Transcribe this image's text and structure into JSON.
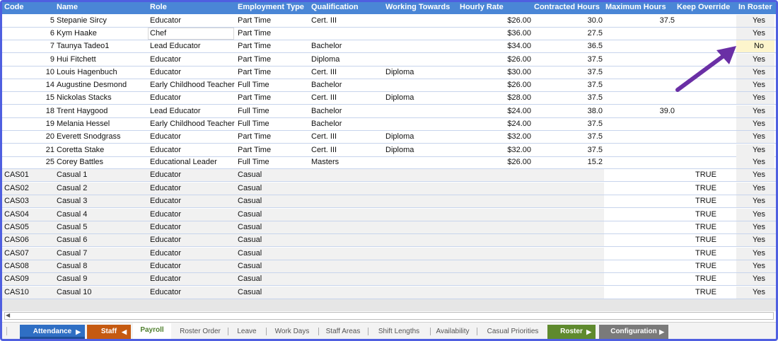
{
  "columns": [
    "Code",
    "Name",
    "Role",
    "Employment Type",
    "Qualification",
    "Working Towards",
    "Hourly Rate",
    "Contracted Hours",
    "Maximum Hours",
    "Keep Override",
    "In Roster"
  ],
  "staff_rows": [
    {
      "code": "5",
      "name": "Stepanie Sircy",
      "role": "Educator",
      "type": "Part Time",
      "qual": "Cert. III",
      "toward": "",
      "rate": "$26.00",
      "contracted": "30.0",
      "max": "37.5",
      "override": "",
      "roster": "Yes"
    },
    {
      "code": "6",
      "name": "Kym Haake",
      "role": "Chef",
      "type": "Part Time",
      "qual": "",
      "toward": "",
      "rate": "$36.00",
      "contracted": "27.5",
      "max": "",
      "override": "",
      "roster": "Yes"
    },
    {
      "code": "7",
      "name": "Taunya Tadeo1",
      "role": "Lead Educator",
      "type": "Part Time",
      "qual": "Bachelor",
      "toward": "",
      "rate": "$34.00",
      "contracted": "36.5",
      "max": "",
      "override": "",
      "roster": "No"
    },
    {
      "code": "9",
      "name": "Hui Fitchett",
      "role": "Educator",
      "type": "Part Time",
      "qual": "Diploma",
      "toward": "",
      "rate": "$26.00",
      "contracted": "37.5",
      "max": "",
      "override": "",
      "roster": "Yes"
    },
    {
      "code": "10",
      "name": "Louis Hagenbuch",
      "role": "Educator",
      "type": "Part Time",
      "qual": "Cert. III",
      "toward": "Diploma",
      "rate": "$30.00",
      "contracted": "37.5",
      "max": "",
      "override": "",
      "roster": "Yes"
    },
    {
      "code": "14",
      "name": "Augustine Desmond",
      "role": "Early Childhood Teacher",
      "type": "Full Time",
      "qual": "Bachelor",
      "toward": "",
      "rate": "$26.00",
      "contracted": "37.5",
      "max": "",
      "override": "",
      "roster": "Yes"
    },
    {
      "code": "15",
      "name": "Nickolas Stacks",
      "role": "Educator",
      "type": "Part Time",
      "qual": "Cert. III",
      "toward": "Diploma",
      "rate": "$28.00",
      "contracted": "37.5",
      "max": "",
      "override": "",
      "roster": "Yes"
    },
    {
      "code": "18",
      "name": "Trent Haygood",
      "role": "Lead Educator",
      "type": "Full Time",
      "qual": "Bachelor",
      "toward": "",
      "rate": "$24.00",
      "contracted": "38.0",
      "max": "39.0",
      "override": "",
      "roster": "Yes"
    },
    {
      "code": "19",
      "name": "Melania Hessel",
      "role": "Early Childhood Teacher",
      "type": "Full Time",
      "qual": "Bachelor",
      "toward": "",
      "rate": "$24.00",
      "contracted": "37.5",
      "max": "",
      "override": "",
      "roster": "Yes"
    },
    {
      "code": "20",
      "name": "Everett Snodgrass",
      "role": "Educator",
      "type": "Part Time",
      "qual": "Cert. III",
      "toward": "Diploma",
      "rate": "$32.00",
      "contracted": "37.5",
      "max": "",
      "override": "",
      "roster": "Yes"
    },
    {
      "code": "21",
      "name": "Coretta Stake",
      "role": "Educator",
      "type": "Part Time",
      "qual": "Cert. III",
      "toward": "Diploma",
      "rate": "$32.00",
      "contracted": "37.5",
      "max": "",
      "override": "",
      "roster": "Yes"
    },
    {
      "code": "25",
      "name": "Corey Battles",
      "role": "Educational Leader",
      "type": "Full Time",
      "qual": "Masters",
      "toward": "",
      "rate": "$26.00",
      "contracted": "15.2",
      "max": "",
      "override": "",
      "roster": "Yes"
    }
  ],
  "casual_rows": [
    {
      "code": "CAS01",
      "name": "Casual 1",
      "role": "Educator",
      "type": "Casual",
      "override": "TRUE",
      "roster": "Yes"
    },
    {
      "code": "CAS02",
      "name": "Casual 2",
      "role": "Educator",
      "type": "Casual",
      "override": "TRUE",
      "roster": "Yes"
    },
    {
      "code": "CAS03",
      "name": "Casual 3",
      "role": "Educator",
      "type": "Casual",
      "override": "TRUE",
      "roster": "Yes"
    },
    {
      "code": "CAS04",
      "name": "Casual 4",
      "role": "Educator",
      "type": "Casual",
      "override": "TRUE",
      "roster": "Yes"
    },
    {
      "code": "CAS05",
      "name": "Casual 5",
      "role": "Educator",
      "type": "Casual",
      "override": "TRUE",
      "roster": "Yes"
    },
    {
      "code": "CAS06",
      "name": "Casual 6",
      "role": "Educator",
      "type": "Casual",
      "override": "TRUE",
      "roster": "Yes"
    },
    {
      "code": "CAS07",
      "name": "Casual 7",
      "role": "Educator",
      "type": "Casual",
      "override": "TRUE",
      "roster": "Yes"
    },
    {
      "code": "CAS08",
      "name": "Casual 8",
      "role": "Educator",
      "type": "Casual",
      "override": "TRUE",
      "roster": "Yes"
    },
    {
      "code": "CAS09",
      "name": "Casual 9",
      "role": "Educator",
      "type": "Casual",
      "override": "TRUE",
      "roster": "Yes"
    },
    {
      "code": "CAS10",
      "name": "Casual 10",
      "role": "Educator",
      "type": "Casual",
      "override": "TRUE",
      "roster": "Yes"
    }
  ],
  "tabs": [
    {
      "label": "Attendance",
      "style": "blue",
      "arrow": "▶"
    },
    {
      "label": "Staff",
      "style": "orange",
      "arrow": "◀"
    },
    {
      "label": "Payroll",
      "style": "active",
      "arrow": ""
    },
    {
      "label": "Roster Order",
      "style": "plain",
      "arrow": ""
    },
    {
      "label": "Leave",
      "style": "plain",
      "arrow": ""
    },
    {
      "label": "Work Days",
      "style": "plain",
      "arrow": ""
    },
    {
      "label": "Staff Areas",
      "style": "plain",
      "arrow": ""
    },
    {
      "label": "Shift Lengths",
      "style": "plain",
      "arrow": ""
    },
    {
      "label": "Availability",
      "style": "plain",
      "arrow": ""
    },
    {
      "label": "Casual Priorities",
      "style": "plain",
      "arrow": ""
    },
    {
      "label": "Roster",
      "style": "green",
      "arrow": "▶"
    },
    {
      "label": "Configuration",
      "style": "gray",
      "arrow": "▶"
    }
  ],
  "colors": {
    "header": "#4a86d6",
    "blue_tab": "#2f6fc4",
    "orange_tab": "#c55a11",
    "green_tab": "#5f8a2e",
    "gray_tab": "#7a7a7a",
    "arrow": "#6a2fa5",
    "highlight": "#fdf5cc"
  },
  "icons": {
    "scroll_left": "◀"
  }
}
